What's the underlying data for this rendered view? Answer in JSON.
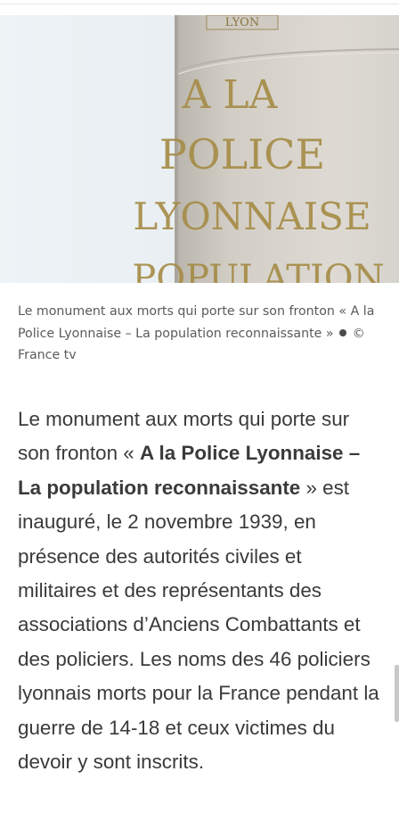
{
  "figure": {
    "image_alt": "Monument aux morts",
    "inscription_lines": [
      "LYON",
      "A LA",
      "POLICE",
      "LYONNAISE",
      "POPULATION"
    ]
  },
  "caption": {
    "text": "Le monument aux morts qui porte sur son fronton « A la Police Lyonnaise – La population reconnaissante »",
    "separator_icon": "bullet-dot",
    "credit": "© France tv"
  },
  "article": {
    "p1_intro": "Le monument aux morts qui porte sur son fronton « ",
    "p1_bold": "A la Police Lyonnaise – La population reconnaissante",
    "p1_rest": " » est inauguré, le 2 novembre 1939, en présence des autorités civiles et militaires et des représentants des associations d’Anciens Combattants et des policiers. Les noms des 46 policiers lyonnais morts pour la France pendant la guerre de 14-18 et ceux victimes du devoir y sont inscrits."
  }
}
